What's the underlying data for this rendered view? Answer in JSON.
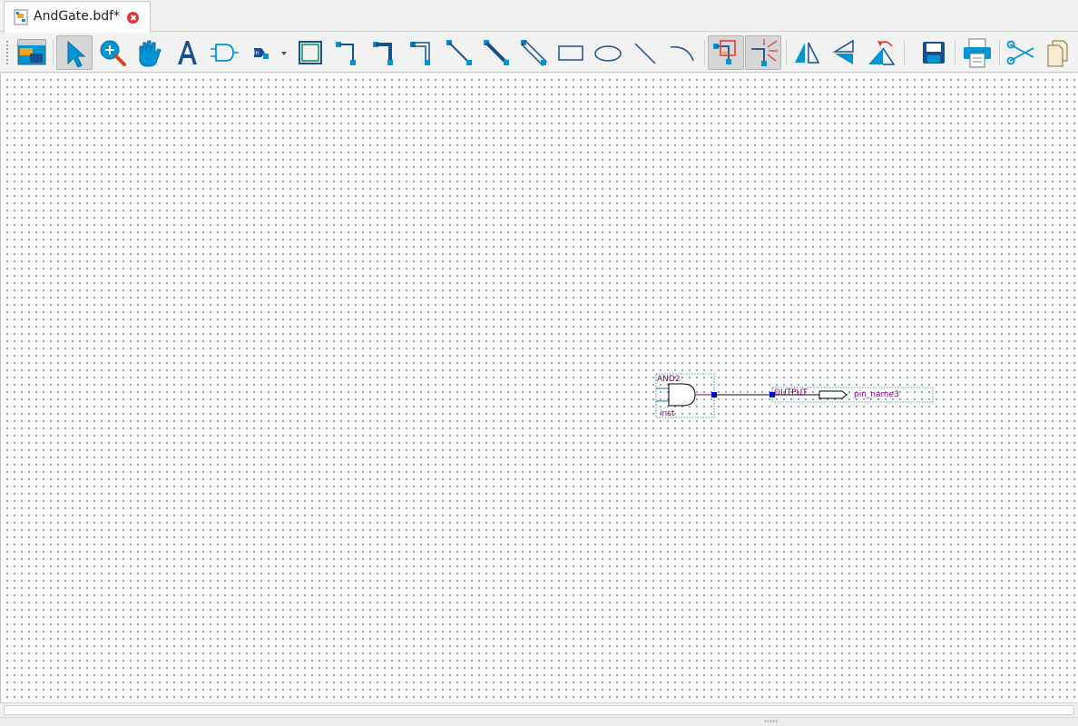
{
  "tab": {
    "title": "AndGate.bdf*",
    "icon": "bdf-file-icon",
    "close_icon": "close-icon"
  },
  "toolbar": {
    "items": [
      {
        "name": "toggle-window-button",
        "icon": "window-icon"
      },
      {
        "name": "selection-tool-button",
        "icon": "pointer-icon",
        "active": true
      },
      {
        "name": "zoom-tool-button",
        "icon": "zoom-icon"
      },
      {
        "name": "hand-tool-button",
        "icon": "hand-icon"
      },
      {
        "name": "text-tool-button",
        "icon": "text-icon"
      },
      {
        "name": "symbol-tool-button",
        "icon": "and-gate-icon"
      },
      {
        "name": "pin-tool-button",
        "icon": "pin-icon"
      },
      {
        "name": "block-tool-button",
        "icon": "block-icon"
      },
      {
        "name": "orthogonal-node-tool-button",
        "icon": "orthogonal-node-icon"
      },
      {
        "name": "orthogonal-bus-tool-button",
        "icon": "orthogonal-bus-icon"
      },
      {
        "name": "orthogonal-conduit-tool-button",
        "icon": "orthogonal-conduit-icon"
      },
      {
        "name": "diagonal-node-tool-button",
        "icon": "diagonal-node-icon"
      },
      {
        "name": "diagonal-bus-tool-button",
        "icon": "diagonal-bus-icon"
      },
      {
        "name": "diagonal-conduit-tool-button",
        "icon": "diagonal-conduit-icon"
      },
      {
        "name": "rectangle-tool-button",
        "icon": "rectangle-icon"
      },
      {
        "name": "oval-tool-button",
        "icon": "oval-icon"
      },
      {
        "name": "line-tool-button",
        "icon": "line-icon"
      },
      {
        "name": "arc-tool-button",
        "icon": "arc-icon"
      },
      {
        "name": "rubberbanding-button",
        "icon": "rubberbanding-icon",
        "active": true
      },
      {
        "name": "partial-line-selection-button",
        "icon": "partial-line-selection-icon",
        "active": true
      },
      {
        "name": "flip-horizontal-button",
        "icon": "flip-horizontal-icon"
      },
      {
        "name": "flip-vertical-button",
        "icon": "flip-vertical-icon"
      },
      {
        "name": "rotate-left-button",
        "icon": "rotate-left-icon"
      },
      {
        "name": "save-button",
        "icon": "save-icon"
      },
      {
        "name": "print-button",
        "icon": "print-icon"
      },
      {
        "name": "cut-button",
        "icon": "cut-icon"
      },
      {
        "name": "copy-button",
        "icon": "copy-icon"
      }
    ],
    "accent": "#0096d6",
    "dark_accent": "#1a4f8f"
  },
  "schematic": {
    "gate": {
      "type_label": "AND2",
      "instance_label": "inst"
    },
    "output_pin": {
      "direction_label": "OUTPUT",
      "pin_name": "pin_name3"
    },
    "label_color": "#800080",
    "box_color": "#008080",
    "node_color": "#0000cc"
  }
}
